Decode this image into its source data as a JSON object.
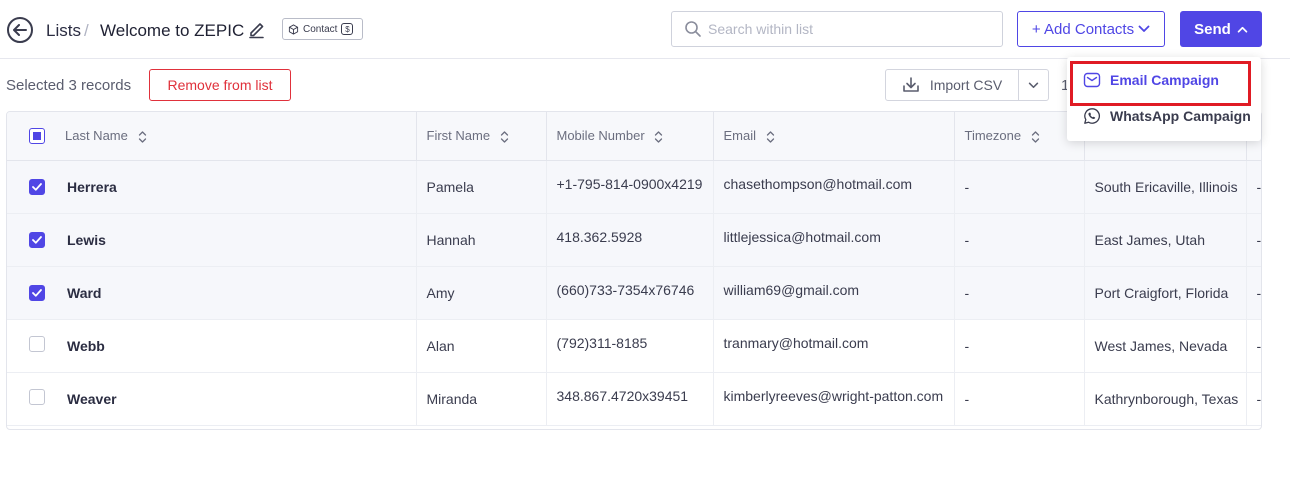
{
  "header": {
    "breadcrumb_root": "Lists",
    "separator": "/",
    "title": "Welcome to ZEPIC",
    "badge_label": "Contact",
    "badge_coin": "$",
    "search_placeholder": "Search within list",
    "add_contacts_label": "+ Add Contacts",
    "send_label": "Send"
  },
  "toolbar": {
    "selected_text": "Selected 3 records",
    "remove_label": "Remove from list",
    "import_label": "Import CSV",
    "pager_text": "1"
  },
  "table": {
    "columns": [
      "Last Name",
      "First Name",
      "Mobile Number",
      "Email",
      "Timezone"
    ],
    "rows": [
      {
        "selected": true,
        "last": "Herrera",
        "first": "Pamela",
        "mobile": "+1-795-814-0900x4219",
        "email": "chasethompson@hotmail.com",
        "timezone": "-",
        "location": "South Ericaville, Illinois",
        "extra": "-"
      },
      {
        "selected": true,
        "last": "Lewis",
        "first": "Hannah",
        "mobile": "418.362.5928",
        "email": "littlejessica@hotmail.com",
        "timezone": "-",
        "location": "East James, Utah",
        "extra": "-"
      },
      {
        "selected": true,
        "last": "Ward",
        "first": "Amy",
        "mobile": "(660)733-7354x76746",
        "email": "william69@gmail.com",
        "timezone": "-",
        "location": "Port Craigfort, Florida",
        "extra": "-"
      },
      {
        "selected": false,
        "last": "Webb",
        "first": "Alan",
        "mobile": "(792)311-8185",
        "email": "tranmary@hotmail.com",
        "timezone": "-",
        "location": "West James, Nevada",
        "extra": "-"
      },
      {
        "selected": false,
        "last": "Weaver",
        "first": "Miranda",
        "mobile": "348.867.4720x39451",
        "email": "kimberlyreeves@wright-patton.com",
        "timezone": "-",
        "location": "Kathrynborough, Texas",
        "extra": "-"
      }
    ]
  },
  "send_menu": {
    "items": [
      {
        "label": "Email Campaign",
        "icon": "mail-icon"
      },
      {
        "label": "WhatsApp Campaign",
        "icon": "whatsapp-icon"
      }
    ]
  },
  "colors": {
    "accent": "#5046e5",
    "danger": "#e0313b",
    "highlight": "#e01b24"
  }
}
